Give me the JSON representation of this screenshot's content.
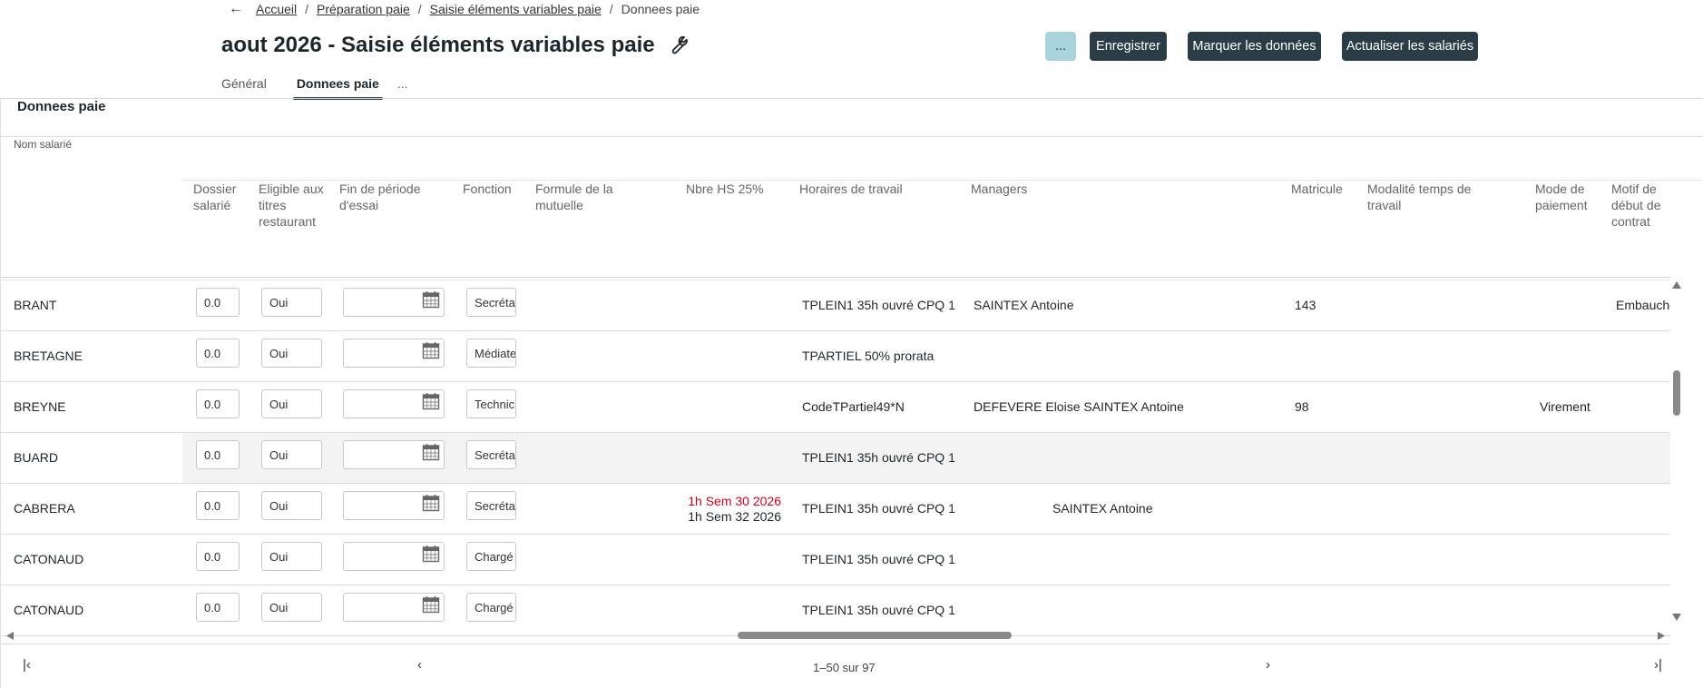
{
  "breadcrumb": {
    "items": [
      "Accueil",
      "Préparation paie",
      "Saisie éléments variables paie"
    ],
    "current": "Donnees paie",
    "separator": "/"
  },
  "header": {
    "title": "aout 2026 - Saisie éléments variables paie",
    "more_label": "...",
    "save_label": "Enregistrer",
    "mark_label": "Marquer les données",
    "refresh_label": "Actualiser les salariés"
  },
  "tabs": [
    {
      "label": "Général",
      "active": false
    },
    {
      "label": "Donnees paie",
      "active": true
    },
    {
      "label": "...",
      "active": false
    }
  ],
  "panel": {
    "title": "Donnees paie",
    "name_column": "Nom salarié"
  },
  "columns": {
    "dossier": "Dossier salarié",
    "eligible": "Eligible aux titres restaurant",
    "fin_essai": "Fin de période d'essai",
    "fonction": "Fonction",
    "mutuelle": "Formule de la mutuelle",
    "hs25": "Nbre HS 25%",
    "horaires": "Horaires de travail",
    "managers": "Managers",
    "matricule": "Matricule",
    "modalite": "Modalité temps de travail",
    "paiement": "Mode de paiement",
    "motif": "Motif de début de contrat"
  },
  "rows": [
    {
      "name": "BRANT",
      "dossier": "0.0",
      "eligible": "Oui",
      "fonction": "Secrétaire",
      "hs_line1": "",
      "hs_line2": "",
      "horaires": "TPLEIN1 35h ouvré CPQ 1",
      "managers": "SAINTEX Antoine",
      "matricule": "143",
      "paiement": "",
      "motif": "Embauche"
    },
    {
      "name": "BRETAGNE",
      "dossier": "0.0",
      "eligible": "Oui",
      "fonction": "Médiateur",
      "hs_line1": "",
      "hs_line2": "",
      "horaires": "TPARTIEL 50% prorata",
      "managers": "",
      "matricule": "",
      "paiement": "",
      "motif": ""
    },
    {
      "name": "BREYNE",
      "dossier": "0.0",
      "eligible": "Oui",
      "fonction": "Technicien",
      "hs_line1": "",
      "hs_line2": "",
      "horaires": "CodeTPartiel49*N",
      "managers": "DEFEVERE Eloise SAINTEX Antoine",
      "matricule": "98",
      "paiement": "Virement",
      "motif": ""
    },
    {
      "name": "BUARD",
      "dossier": "0.0",
      "eligible": "Oui",
      "fonction": "Secrétaire",
      "hs_line1": "",
      "hs_line2": "",
      "horaires": "TPLEIN1 35h ouvré CPQ 1",
      "managers": "",
      "matricule": "",
      "paiement": "",
      "motif": "",
      "highlight": true
    },
    {
      "name": "CABRERA",
      "dossier": "0.0",
      "eligible": "Oui",
      "fonction": "Secrétaire",
      "hs_line1": "1h Sem 30 2026",
      "hs_line2": "1h Sem 32 2026",
      "horaires": "TPLEIN1 35h ouvré CPQ 1",
      "managers": "SAINTEX Antoine",
      "managers_offset": true,
      "matricule": "",
      "paiement": "",
      "motif": ""
    },
    {
      "name": "CATONAUD",
      "dossier": "0.0",
      "eligible": "Oui",
      "fonction": "Chargé",
      "hs_line1": "",
      "hs_line2": "",
      "horaires": "TPLEIN1 35h ouvré CPQ 1",
      "managers": "",
      "matricule": "",
      "paiement": "",
      "motif": ""
    },
    {
      "name": "CATONAUD",
      "dossier": "0.0",
      "eligible": "Oui",
      "fonction": "Chargé",
      "hs_line1": "",
      "hs_line2": "",
      "horaires": "TPLEIN1 35h ouvré CPQ 1",
      "managers": "",
      "matricule": "",
      "paiement": "",
      "motif": ""
    }
  ],
  "pagination": {
    "info": "1–50 sur 97"
  },
  "colors": {
    "primary": "#2a3d46",
    "more_button": "#a9d3dc",
    "alert_red": "#d0021b"
  }
}
